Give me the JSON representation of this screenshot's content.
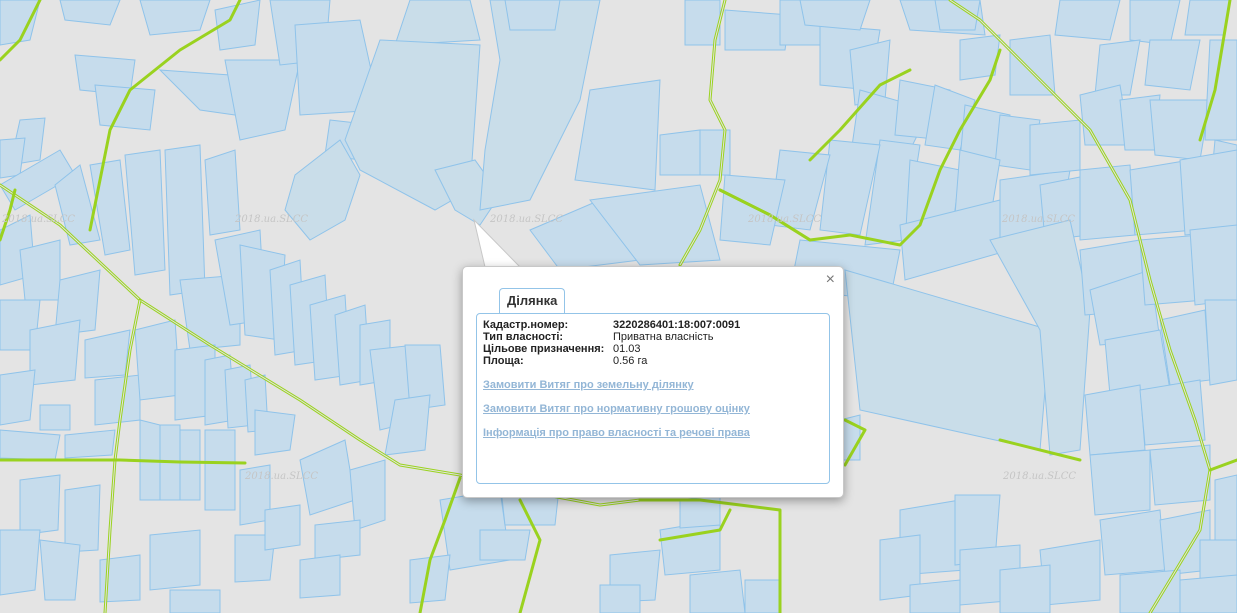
{
  "map": {
    "watermarks": [
      "2018.ua.SLCC",
      "2018.ua.SLCC",
      "2018.ua.SLCC",
      "2018.ua.SLCC",
      "2018.ua.SLCC",
      "2018.ua.SLCC",
      "2018.ua.SLCC"
    ]
  },
  "popup": {
    "close_icon": "×",
    "tab_label": "Ділянка",
    "fields": [
      {
        "key": "Кадастр.номер:",
        "value": "3220286401:18:007:0091"
      },
      {
        "key": "Тип власності:",
        "value": "Приватна власність"
      },
      {
        "key": "Цільове призначення:",
        "value": "01.03"
      },
      {
        "key": "Площа:",
        "value": "0.56 га"
      }
    ],
    "links": [
      "Замовити Витяг про земельну ділянку",
      "Замовити Витяг про нормативну грошову оцінку",
      "Інформація про право власності та речові права"
    ]
  }
}
